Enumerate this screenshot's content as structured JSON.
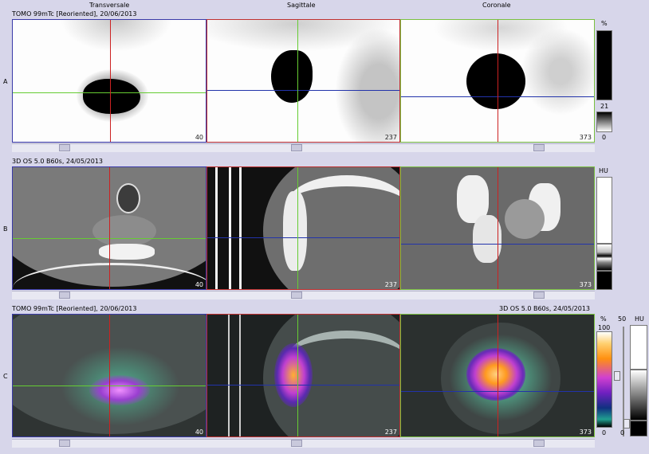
{
  "columns": {
    "transversal": "Transversale",
    "sagittal": "Sagittale",
    "coronal": "Coronale"
  },
  "rows": {
    "a": {
      "label": "A",
      "series": "TOMO 99mTc [Reoriented], 20/06/2013",
      "slices": [
        "40",
        "237",
        "373"
      ],
      "scale_unit": "%",
      "scale_value": "21",
      "scale_min": "0"
    },
    "b": {
      "label": "B",
      "series": "3D  OS  5.0  B60s, 24/05/2013",
      "slices": [
        "40",
        "237",
        "373"
      ],
      "scale_unit": "HU"
    },
    "c": {
      "label": "C",
      "series_left": "TOMO 99mTc [Reoriented], 20/06/2013",
      "series_right": "3D  OS  5.0  B60s, 24/05/2013",
      "slices": [
        "40",
        "237",
        "373"
      ],
      "scale_unit": "%",
      "scale_max": "100",
      "scale_min": "0",
      "slider_value": "50",
      "ct_unit": "HU",
      "ct_min": "0"
    }
  },
  "colors": {
    "transversal_frame": "#3a3aa8",
    "sagittal_frame": "#c03030",
    "coronal_frame": "#7ac040",
    "crosshair_green": "#66cc33",
    "crosshair_red": "#cc2222",
    "crosshair_blue": "#2233aa"
  }
}
